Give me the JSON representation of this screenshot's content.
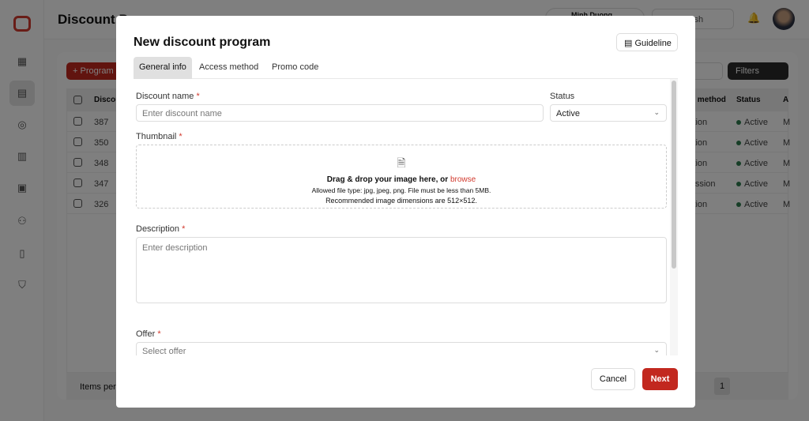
{
  "app": {
    "page_title": "Discount Programs",
    "user_name": "Minh Duong",
    "language": "English",
    "add_button": "+ Program",
    "filters": "Filters",
    "items_per_page": "Items per page",
    "page": "1"
  },
  "table": {
    "headers": [
      "Discount ID",
      "Access method",
      "Status",
      "A"
    ],
    "rows": [
      {
        "id": "387",
        "method": "Promotion",
        "status": "Active",
        "a": "M"
      },
      {
        "id": "350",
        "method": "Promotion",
        "status": "Active",
        "a": "M"
      },
      {
        "id": "348",
        "method": "Promotion",
        "status": "Active",
        "a": "M"
      },
      {
        "id": "347",
        "method": "Commission",
        "status": "Active",
        "a": "M"
      },
      {
        "id": "326",
        "method": "Promotion",
        "status": "Active",
        "a": "M"
      }
    ]
  },
  "modal": {
    "title": "New discount program",
    "guideline": "Guideline",
    "tabs": [
      "General info",
      "Access method",
      "Promo code"
    ],
    "discount_name": {
      "label": "Discount name",
      "placeholder": "Enter discount name"
    },
    "status": {
      "label": "Status",
      "value": "Active"
    },
    "thumbnail": {
      "label": "Thumbnail",
      "drag_text": "Drag & drop your image here, or ",
      "browse": "browse",
      "allowed": "Allowed file type: jpg, jpeg, png. File must be less than 5MB.",
      "recommended": "Recommended image dimensions are 512×512."
    },
    "description": {
      "label": "Description",
      "placeholder": "Enter description"
    },
    "offer": {
      "label": "Offer",
      "placeholder": "Select offer"
    },
    "required_mark": "*",
    "cancel": "Cancel",
    "next": "Next"
  },
  "colors": {
    "accent": "#c2281f",
    "active_status": "#2e7d4f"
  }
}
